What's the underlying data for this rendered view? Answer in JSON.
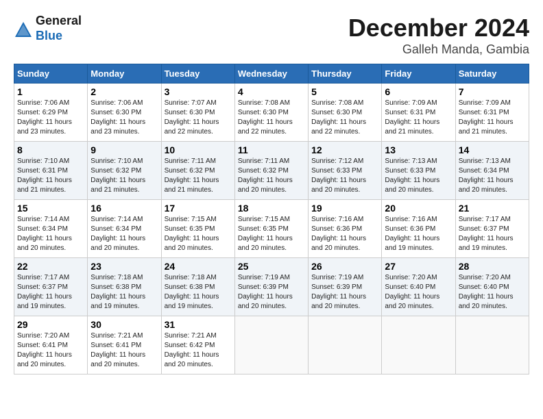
{
  "header": {
    "logo_line1": "General",
    "logo_line2": "Blue",
    "month": "December 2024",
    "location": "Galleh Manda, Gambia"
  },
  "days_of_week": [
    "Sunday",
    "Monday",
    "Tuesday",
    "Wednesday",
    "Thursday",
    "Friday",
    "Saturday"
  ],
  "weeks": [
    [
      {
        "day": "1",
        "sunrise": "7:06 AM",
        "sunset": "6:29 PM",
        "daylight": "11 hours and 23 minutes."
      },
      {
        "day": "2",
        "sunrise": "7:06 AM",
        "sunset": "6:30 PM",
        "daylight": "11 hours and 23 minutes."
      },
      {
        "day": "3",
        "sunrise": "7:07 AM",
        "sunset": "6:30 PM",
        "daylight": "11 hours and 22 minutes."
      },
      {
        "day": "4",
        "sunrise": "7:08 AM",
        "sunset": "6:30 PM",
        "daylight": "11 hours and 22 minutes."
      },
      {
        "day": "5",
        "sunrise": "7:08 AM",
        "sunset": "6:30 PM",
        "daylight": "11 hours and 22 minutes."
      },
      {
        "day": "6",
        "sunrise": "7:09 AM",
        "sunset": "6:31 PM",
        "daylight": "11 hours and 21 minutes."
      },
      {
        "day": "7",
        "sunrise": "7:09 AM",
        "sunset": "6:31 PM",
        "daylight": "11 hours and 21 minutes."
      }
    ],
    [
      {
        "day": "8",
        "sunrise": "7:10 AM",
        "sunset": "6:31 PM",
        "daylight": "11 hours and 21 minutes."
      },
      {
        "day": "9",
        "sunrise": "7:10 AM",
        "sunset": "6:32 PM",
        "daylight": "11 hours and 21 minutes."
      },
      {
        "day": "10",
        "sunrise": "7:11 AM",
        "sunset": "6:32 PM",
        "daylight": "11 hours and 21 minutes."
      },
      {
        "day": "11",
        "sunrise": "7:11 AM",
        "sunset": "6:32 PM",
        "daylight": "11 hours and 20 minutes."
      },
      {
        "day": "12",
        "sunrise": "7:12 AM",
        "sunset": "6:33 PM",
        "daylight": "11 hours and 20 minutes."
      },
      {
        "day": "13",
        "sunrise": "7:13 AM",
        "sunset": "6:33 PM",
        "daylight": "11 hours and 20 minutes."
      },
      {
        "day": "14",
        "sunrise": "7:13 AM",
        "sunset": "6:34 PM",
        "daylight": "11 hours and 20 minutes."
      }
    ],
    [
      {
        "day": "15",
        "sunrise": "7:14 AM",
        "sunset": "6:34 PM",
        "daylight": "11 hours and 20 minutes."
      },
      {
        "day": "16",
        "sunrise": "7:14 AM",
        "sunset": "6:34 PM",
        "daylight": "11 hours and 20 minutes."
      },
      {
        "day": "17",
        "sunrise": "7:15 AM",
        "sunset": "6:35 PM",
        "daylight": "11 hours and 20 minutes."
      },
      {
        "day": "18",
        "sunrise": "7:15 AM",
        "sunset": "6:35 PM",
        "daylight": "11 hours and 20 minutes."
      },
      {
        "day": "19",
        "sunrise": "7:16 AM",
        "sunset": "6:36 PM",
        "daylight": "11 hours and 20 minutes."
      },
      {
        "day": "20",
        "sunrise": "7:16 AM",
        "sunset": "6:36 PM",
        "daylight": "11 hours and 19 minutes."
      },
      {
        "day": "21",
        "sunrise": "7:17 AM",
        "sunset": "6:37 PM",
        "daylight": "11 hours and 19 minutes."
      }
    ],
    [
      {
        "day": "22",
        "sunrise": "7:17 AM",
        "sunset": "6:37 PM",
        "daylight": "11 hours and 19 minutes."
      },
      {
        "day": "23",
        "sunrise": "7:18 AM",
        "sunset": "6:38 PM",
        "daylight": "11 hours and 19 minutes."
      },
      {
        "day": "24",
        "sunrise": "7:18 AM",
        "sunset": "6:38 PM",
        "daylight": "11 hours and 19 minutes."
      },
      {
        "day": "25",
        "sunrise": "7:19 AM",
        "sunset": "6:39 PM",
        "daylight": "11 hours and 20 minutes."
      },
      {
        "day": "26",
        "sunrise": "7:19 AM",
        "sunset": "6:39 PM",
        "daylight": "11 hours and 20 minutes."
      },
      {
        "day": "27",
        "sunrise": "7:20 AM",
        "sunset": "6:40 PM",
        "daylight": "11 hours and 20 minutes."
      },
      {
        "day": "28",
        "sunrise": "7:20 AM",
        "sunset": "6:40 PM",
        "daylight": "11 hours and 20 minutes."
      }
    ],
    [
      {
        "day": "29",
        "sunrise": "7:20 AM",
        "sunset": "6:41 PM",
        "daylight": "11 hours and 20 minutes."
      },
      {
        "day": "30",
        "sunrise": "7:21 AM",
        "sunset": "6:41 PM",
        "daylight": "11 hours and 20 minutes."
      },
      {
        "day": "31",
        "sunrise": "7:21 AM",
        "sunset": "6:42 PM",
        "daylight": "11 hours and 20 minutes."
      },
      null,
      null,
      null,
      null
    ]
  ]
}
